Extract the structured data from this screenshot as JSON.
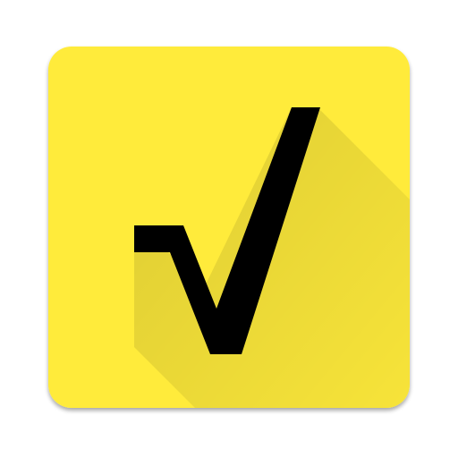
{
  "icon": {
    "name": "square-root-icon",
    "background_color": "#FFEB3B",
    "shadow_color": "#000000",
    "glyph_color": "#000000"
  }
}
